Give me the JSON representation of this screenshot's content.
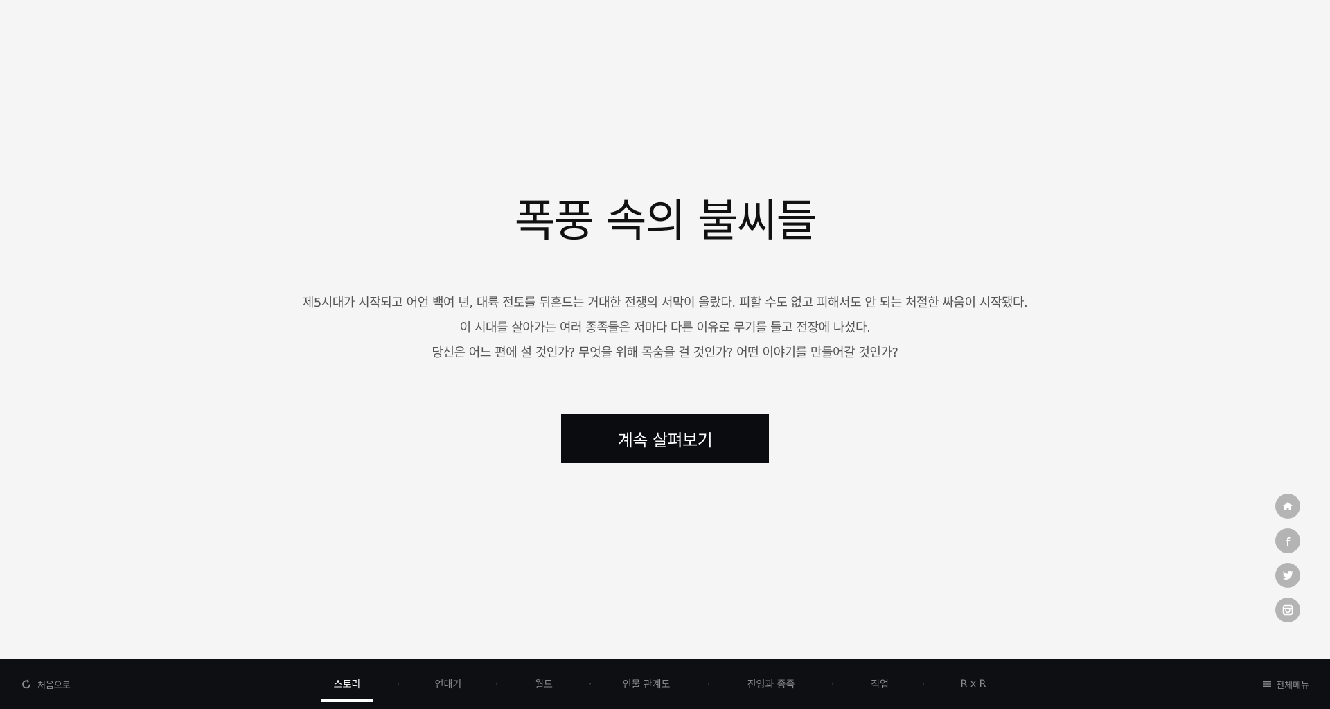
{
  "hero": {
    "title": "폭풍 속의 불씨들",
    "description_lines": [
      "제5시대가 시작되고 어언 백여 년, 대륙 전토를 뒤흔드는 거대한 전쟁의 서막이 올랐다. 피할 수도 없고 피해서도 안 되는 처절한 싸움이 시작됐다.",
      "이 시대를 살아가는 여러 종족들은 저마다 다른 이유로 무기를 들고 전장에 나섰다.",
      "당신은 어느 편에 설 것인가?  무엇을 위해 목숨을 걸 것인가?  어떤 이야기를 만들어갈 것인가?"
    ],
    "cta_label": "계속 살펴보기"
  },
  "social": {
    "items": [
      {
        "icon": "home-icon"
      },
      {
        "icon": "facebook-icon"
      },
      {
        "icon": "twitter-icon"
      },
      {
        "icon": "instagram-icon"
      }
    ]
  },
  "bottom_bar": {
    "restart_label": "처음으로",
    "nav_items": [
      {
        "label": "스토리",
        "active": true
      },
      {
        "label": "연대기",
        "active": false
      },
      {
        "label": "월드",
        "active": false
      },
      {
        "label": "인물 관계도",
        "active": false
      },
      {
        "label": "진영과 종족",
        "active": false
      },
      {
        "label": "직업",
        "active": false
      },
      {
        "label": "R x R",
        "active": false
      }
    ],
    "separator": "·",
    "full_menu_label": "전체메뉴"
  },
  "colors": {
    "background": "#f5f5f5",
    "dark": "#0b0c10",
    "bar": "#0d0f13",
    "social_button": "#b4b4b4"
  }
}
